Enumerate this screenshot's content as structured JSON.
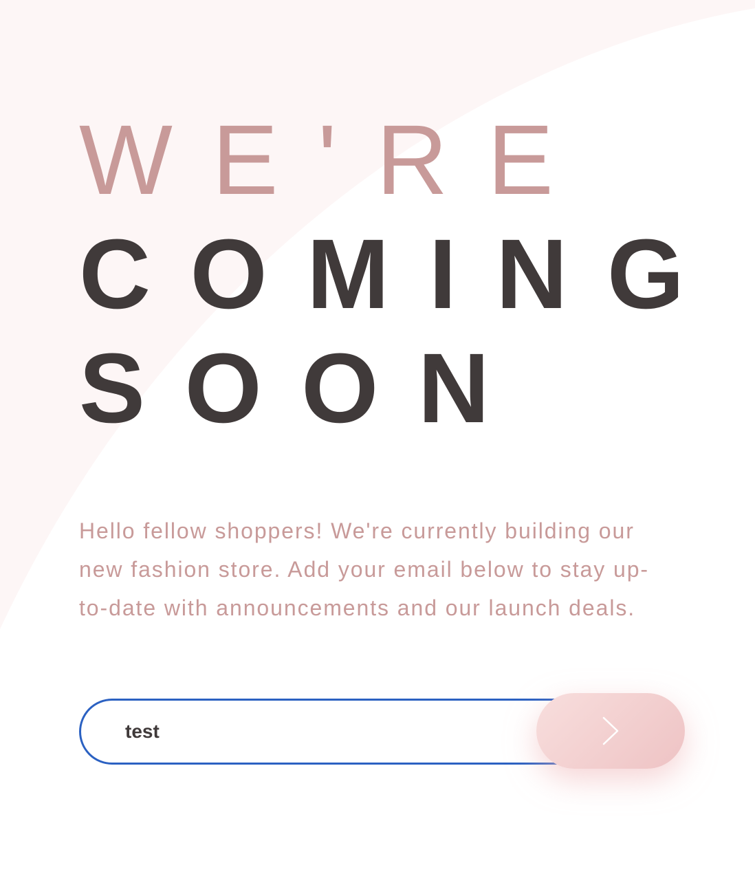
{
  "headline": {
    "line1": "WE'RE",
    "line2": "COMING",
    "line3": "SOON"
  },
  "description": "Hello fellow shoppers! We're currently building our new fashion store. Add your email below to stay up-to-date with announcements and our launch deals.",
  "form": {
    "email_value": "test",
    "submit_icon": "chevron-right-icon"
  },
  "colors": {
    "accent": "#c89a99",
    "heading_dark": "#403a3a",
    "input_focus_border": "#2b61c2",
    "button_gradient_start": "#f8dedd",
    "button_gradient_end": "#eec3c4",
    "background_shape": "#fdf6f6"
  }
}
